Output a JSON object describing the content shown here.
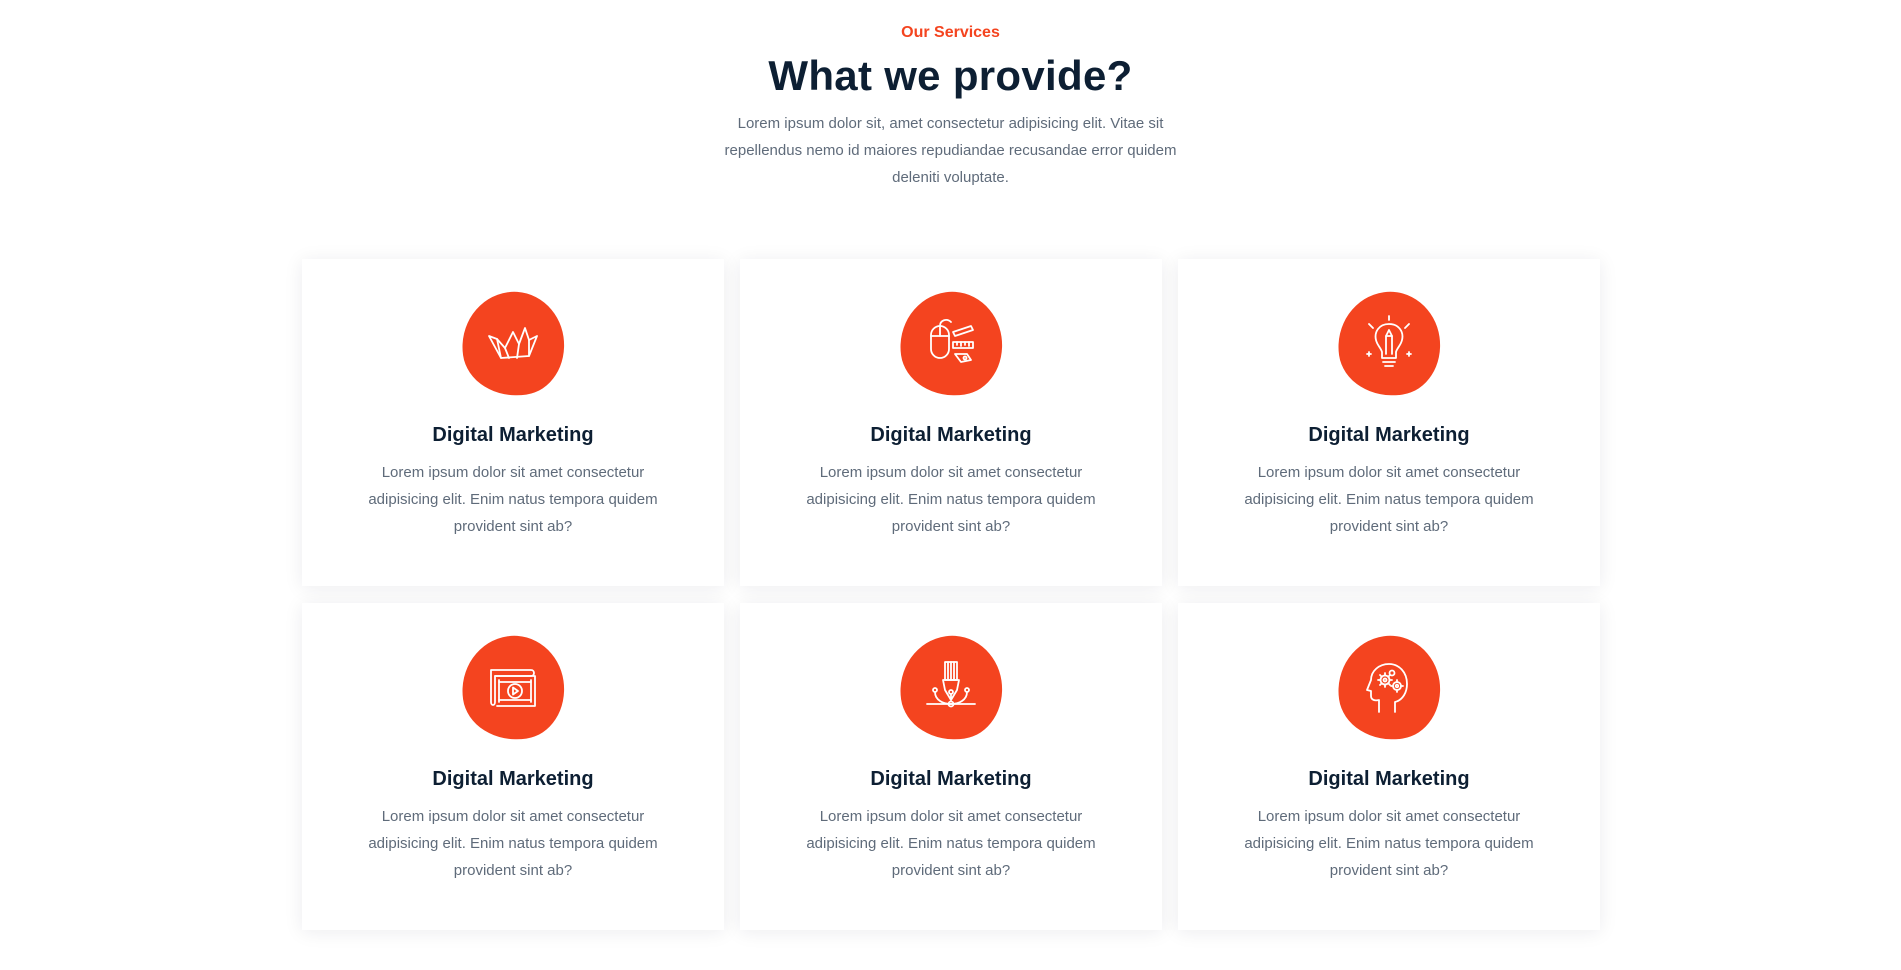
{
  "section": {
    "eyebrow": "Our Services",
    "title": "What we provide?",
    "intro": "Lorem ipsum dolor sit, amet consectetur adipisicing elit. Vitae sit repellendus nemo id maiores repudiandae recusandae error quidem deleniti voluptate."
  },
  "colors": {
    "accent": "#f4441f",
    "heading": "#0d1f33",
    "body_text": "#5f6b7a"
  },
  "services": [
    {
      "icon": "paper-crane-icon",
      "title": "Digital Marketing",
      "text": "Lorem ipsum dolor sit amet consectetur adipisicing elit. Enim natus tempora quidem provident sint ab?"
    },
    {
      "icon": "mouse-design-tools-icon",
      "title": "Digital Marketing",
      "text": "Lorem ipsum dolor sit amet consectetur adipisicing elit. Enim natus tempora quidem provident sint ab?"
    },
    {
      "icon": "lightbulb-pencil-icon",
      "title": "Digital Marketing",
      "text": "Lorem ipsum dolor sit amet consectetur adipisicing elit. Enim natus tempora quidem provident sint ab?"
    },
    {
      "icon": "video-film-icon",
      "title": "Digital Marketing",
      "text": "Lorem ipsum dolor sit amet consectetur adipisicing elit. Enim natus tempora quidem provident sint ab?"
    },
    {
      "icon": "pen-tool-icon",
      "title": "Digital Marketing",
      "text": "Lorem ipsum dolor sit amet consectetur adipisicing elit. Enim natus tempora quidem provident sint ab?"
    },
    {
      "icon": "head-gears-icon",
      "title": "Digital Marketing",
      "text": "Lorem ipsum dolor sit amet consectetur adipisicing elit. Enim natus tempora quidem provident sint ab?"
    }
  ]
}
